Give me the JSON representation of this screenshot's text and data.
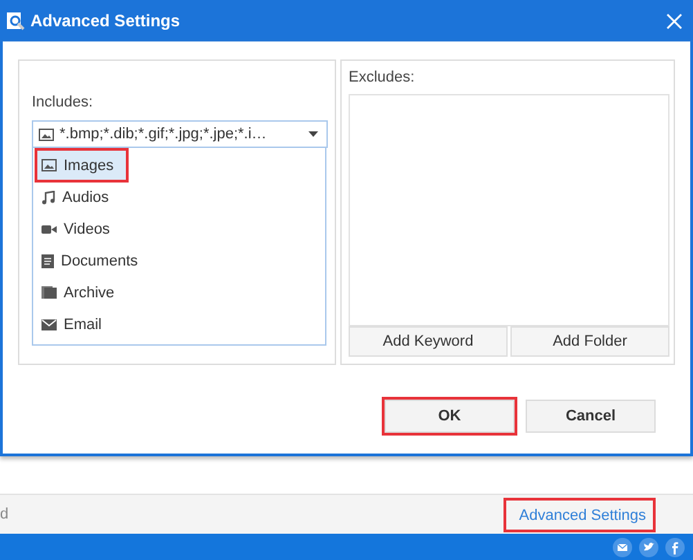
{
  "window": {
    "title": "Advanced Settings"
  },
  "includes": {
    "label": "Includes:",
    "dropdown": {
      "value": "*.bmp;*.dib;*.gif;*.jpg;*.jpe;*.i…",
      "expanded": true
    },
    "options": [
      {
        "label": "Images",
        "kind": "image",
        "selected": true,
        "highlighted": true
      },
      {
        "label": "Audios",
        "kind": "music",
        "selected": false,
        "highlighted": false
      },
      {
        "label": "Videos",
        "kind": "video",
        "selected": false,
        "highlighted": false
      },
      {
        "label": "Documents",
        "kind": "document",
        "selected": false,
        "highlighted": false
      },
      {
        "label": "Archive",
        "kind": "archive",
        "selected": false,
        "highlighted": false
      },
      {
        "label": "Email",
        "kind": "email",
        "selected": false,
        "highlighted": false
      }
    ]
  },
  "excludes": {
    "label": "Excludes:",
    "buttons": [
      "Add Keyword",
      "Add Folder"
    ]
  },
  "buttons": [
    {
      "label": "OK",
      "highlighted": true
    },
    {
      "label": "Cancel",
      "highlighted": false
    }
  ],
  "background_bar": {
    "left_text": "d",
    "link": {
      "label": "Advanced Settings",
      "highlighted": true
    }
  }
}
